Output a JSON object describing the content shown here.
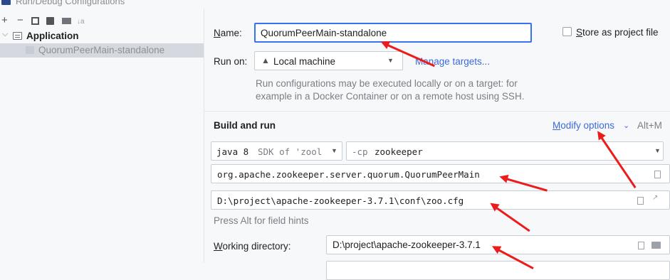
{
  "window": {
    "title": "Run/Debug Configurations"
  },
  "toolbar": {
    "add": "+",
    "remove": "−",
    "sort": "↓a"
  },
  "tree": {
    "group_label": "Application",
    "config_label": "QuorumPeerMain-standalone"
  },
  "form": {
    "name_label": "Name:",
    "name_value": "QuorumPeerMain-standalone",
    "store_label": "Store as project file",
    "runon_label": "Run on:",
    "runon_value": "Local machine",
    "manage_targets": "Manage targets...",
    "info_line1": "Run configurations may be executed locally or on a target: for",
    "info_line2": "example in a Docker Container or on a remote host using SSH.",
    "build_run_title": "Build and run",
    "modify_options": "Modify options",
    "modify_shortcut": "Alt+M",
    "jdk_java": "java 8",
    "jdk_sdk": "SDK of 'zool",
    "cp_prefix": "-cp",
    "cp_module": "zookeeper",
    "main_class": "org.apache.zookeeper.server.quorum.QuorumPeerMain",
    "program_args": "D:\\project\\apache-zookeeper-3.7.1\\conf\\zoo.cfg",
    "hint": "Press Alt for field hints",
    "workdir_label": "Working directory:",
    "workdir_value": "D:\\project\\apache-zookeeper-3.7.1"
  },
  "colors": {
    "accent": "#3574f0",
    "link": "#3b69db",
    "annotation_arrow": "#ec1c1c"
  }
}
